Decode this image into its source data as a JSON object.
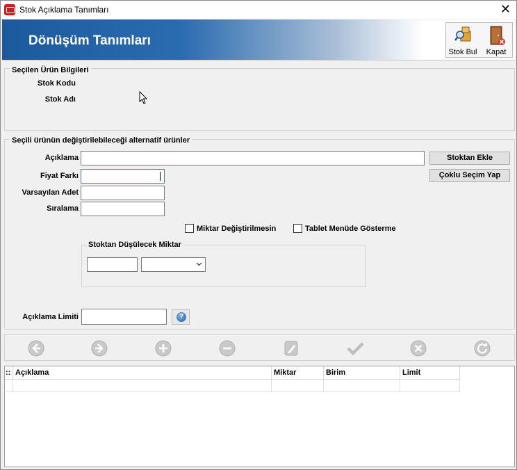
{
  "window": {
    "title": "Stok Açıklama Tanımları",
    "close_icon": "close-icon"
  },
  "header": {
    "title": "Dönüşüm Tanımları",
    "tools": [
      {
        "label": "Stok Bul",
        "icon": "stock-search-icon"
      },
      {
        "label": "Kapat",
        "icon": "exit-door-icon"
      }
    ]
  },
  "selected_product": {
    "title": "Seçilen Ürün Bilgileri",
    "stock_code_label": "Stok Kodu",
    "stock_name_label": "Stok Adı"
  },
  "alternatives": {
    "title": "Seçili ürünün değiştirilebileceği alternatif ürünler",
    "description_label": "Açıklama",
    "price_diff_label": "Fiyat Farkı",
    "default_qty_label": "Varsayılan Adet",
    "order_label": "Sıralama",
    "add_from_stock_button": "Stoktan Ekle",
    "multi_select_button": "Çoklu Seçim Yap",
    "qty_locked_label": "Miktar Değiştirilmesin",
    "tablet_hide_label": "Tablet Menüde Gösterme",
    "deduct_group_title": "Stoktan Düşülecek Miktar",
    "desc_limit_label": "Açıklama Limiti",
    "help_icon": "help-icon"
  },
  "navigation": [
    "back-arrow-icon",
    "forward-arrow-icon",
    "add-icon",
    "remove-icon",
    "edit-icon",
    "confirm-check-icon",
    "cancel-x-icon",
    "refresh-icon"
  ],
  "grid": {
    "row_indicator": "::",
    "columns": [
      "Açıklama",
      "Miktar",
      "Birim",
      "Limit"
    ]
  }
}
